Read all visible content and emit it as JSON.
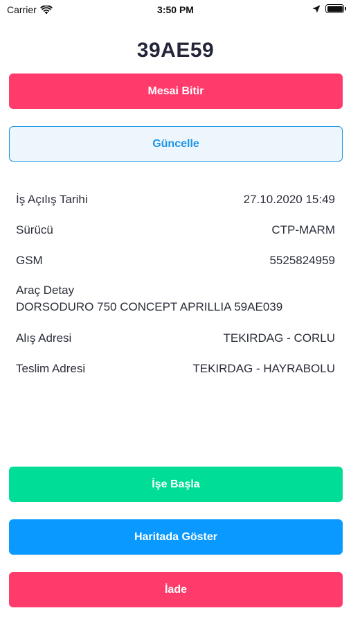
{
  "status_bar": {
    "carrier": "Carrier",
    "time": "3:50 PM",
    "icons": [
      "wifi-icon",
      "location-arrow-icon",
      "battery-icon"
    ]
  },
  "plate": "39AE59",
  "buttons": {
    "end_shift": "Mesai Bitir",
    "update": "Güncelle",
    "start_job": "İşe Başla",
    "show_on_map": "Haritada Göster",
    "return": "İade"
  },
  "details": {
    "open_date_label": "İş Açılış Tarihi",
    "open_date_value": "27.10.2020 15:49",
    "driver_label": "Sürücü",
    "driver_value": "CTP-MARM",
    "gsm_label": "GSM",
    "gsm_value": "5525824959",
    "vehicle_label": "Araç Detay",
    "vehicle_value": "DORSODURO 750 CONCEPT APRILLIA 59AE039",
    "pickup_label": "Alış Adresi",
    "pickup_value": "TEKIRDAG - CORLU",
    "delivery_label": "Teslim Adresi",
    "delivery_value": "TEKIRDAG - HAYRABOLU"
  },
  "colors": {
    "red": "#ff3b6b",
    "green": "#00dd96",
    "blue": "#0a99ff",
    "outline_blue": "#1c95e8",
    "text": "#2b2e3a"
  }
}
